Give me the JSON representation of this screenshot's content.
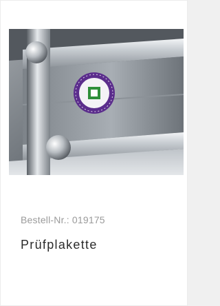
{
  "product": {
    "order_label": "Bestell-Nr.:",
    "order_number": "019175",
    "name": "Prüfplakette",
    "image_icon": "inspection-sticker-on-metal-profile"
  },
  "colors": {
    "sticker_ring": "#5b2d8c",
    "sticker_center": "#2f8f3a"
  }
}
